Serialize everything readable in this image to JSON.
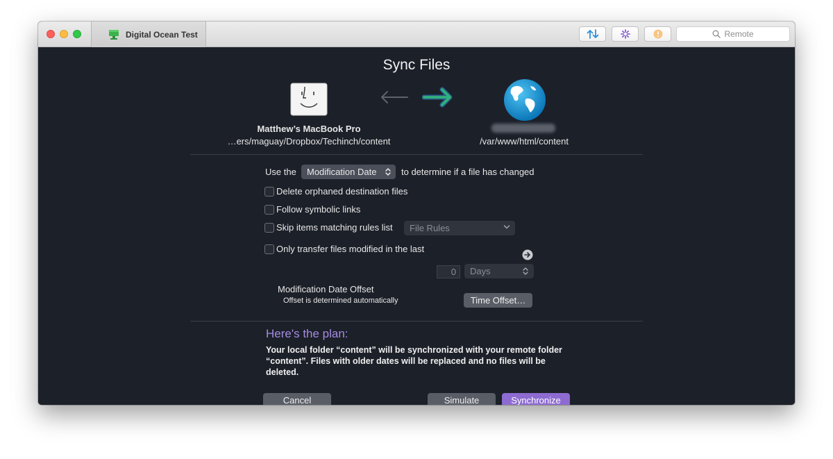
{
  "window": {
    "tab_title": "Digital Ocean Test"
  },
  "toolbar": {
    "transfer_icon": "arrows-up-down-icon",
    "activity_icon": "spinner-icon",
    "info_icon": "info-icon",
    "search_placeholder": "Remote"
  },
  "dialog": {
    "title": "Sync Files",
    "local": {
      "name": "Matthew’s MacBook Pro",
      "path": "…ers/maguay/Dropbox/Techinch/content"
    },
    "remote": {
      "host": "███.███.██.██",
      "path": "/var/www/html/content"
    },
    "compare": {
      "prefix": "Use the",
      "method": "Modification Date",
      "suffix": "to determine if a file has changed"
    },
    "options": {
      "delete_orphaned": "Delete orphaned destination files",
      "follow_symlinks": "Follow symbolic links",
      "skip_matching": "Skip items matching rules list",
      "file_rules_placeholder": "File Rules",
      "only_transfer": "Only transfer files modified in the last",
      "days_value": "0",
      "days_unit": "Days"
    },
    "offset": {
      "title": "Modification Date Offset",
      "subtitle": "Offset is determined automatically",
      "button": "Time Offset…"
    },
    "plan": {
      "title": "Here's the plan:",
      "text": "Your local folder “content” will be synchronized with your remote folder “content”. Files with older dates will be replaced and no files will be deleted."
    },
    "buttons": {
      "cancel": "Cancel",
      "simulate": "Simulate",
      "synchronize": "Synchronize"
    }
  },
  "colors": {
    "background": "#1c2029",
    "accent": "#8e6bd1",
    "plan_title": "#a68be3",
    "arrow_active": "#2fb37a"
  }
}
